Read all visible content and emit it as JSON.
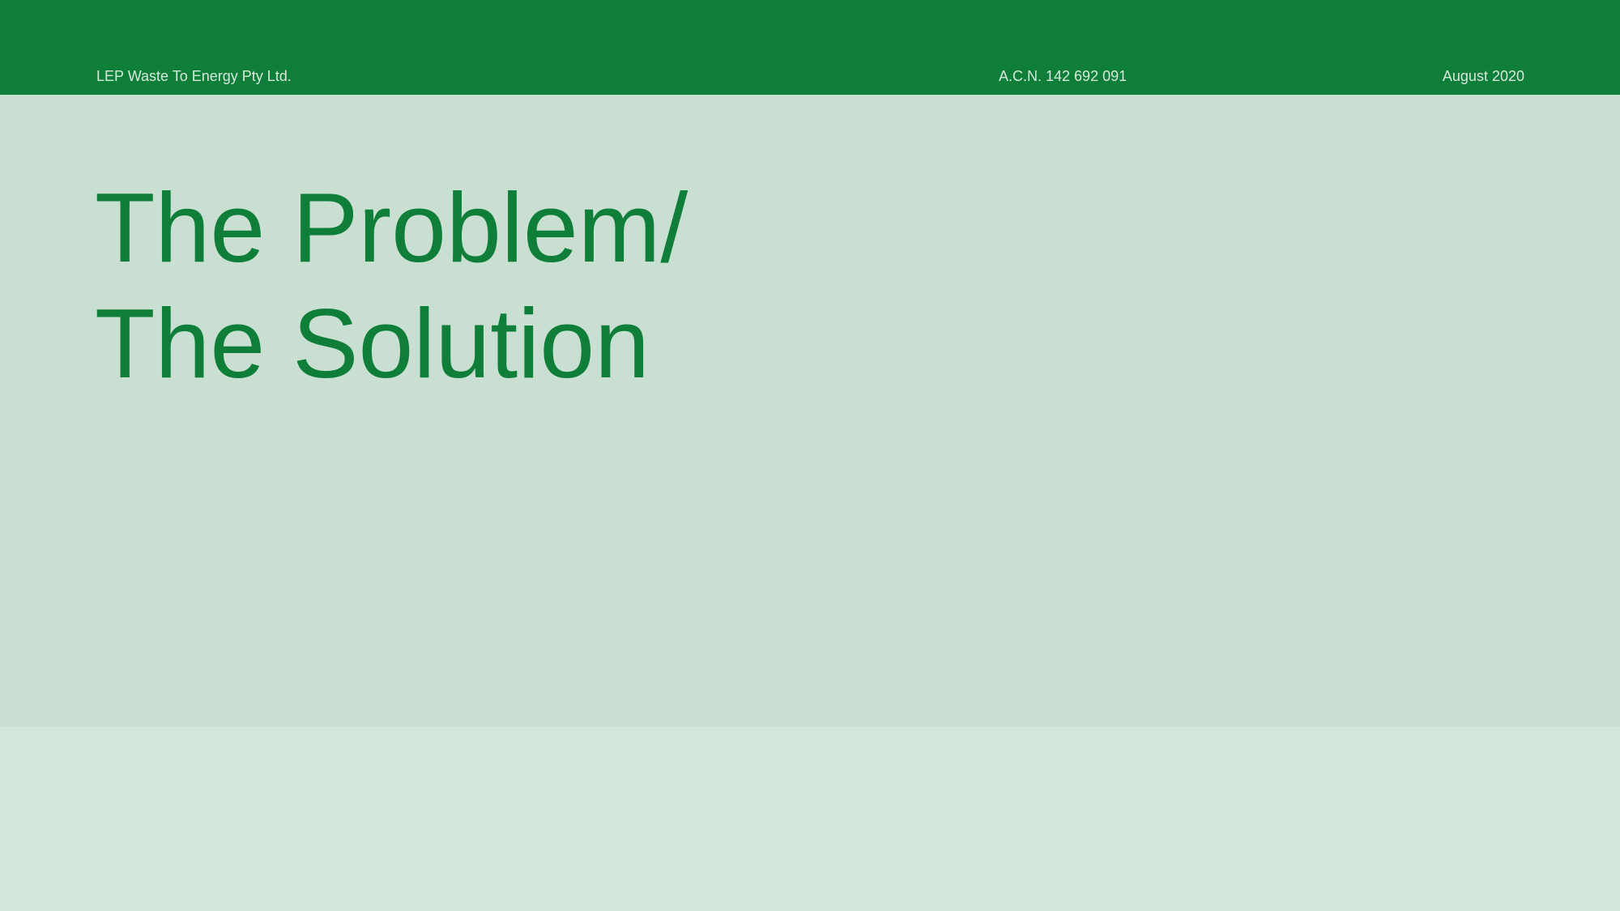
{
  "header": {
    "company": "LEP Waste To Energy Pty Ltd.",
    "acn": "A.C.N. 142 692 091",
    "date": "August 2020"
  },
  "slide": {
    "title_line1": "The Problem/",
    "title_line2": "The Solution"
  },
  "colors": {
    "brand_green": "#0e7e38",
    "panel_green": "#c8dfd2",
    "footer_green": "#d4e6dc"
  }
}
